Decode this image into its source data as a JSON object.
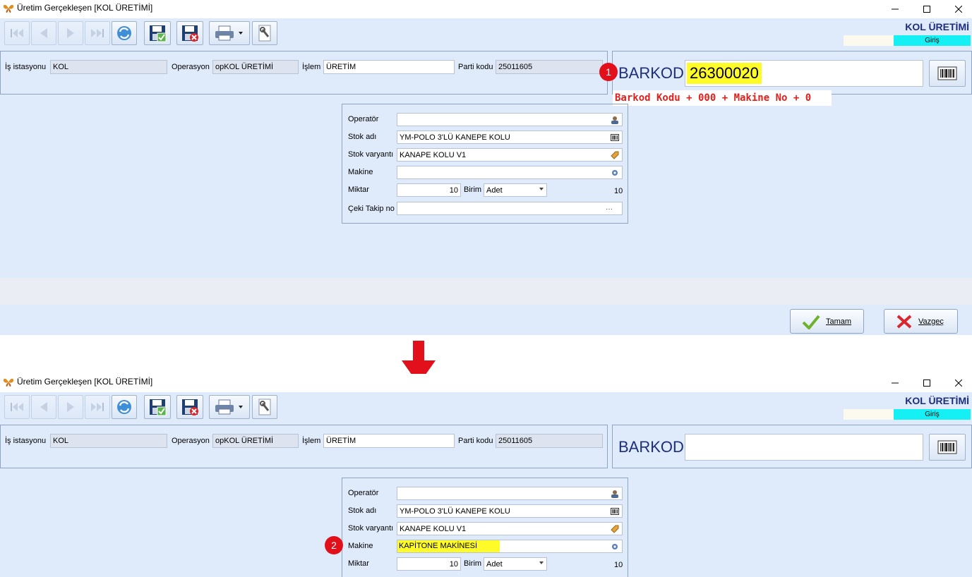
{
  "window": {
    "title": "Üretim Gerçekleşen [KOL ÜRETİMİ]",
    "header_title": "KOL ÜRETİMİ",
    "status": "Giriş"
  },
  "info": {
    "is_istasyonu_label": "İş istasyonu",
    "is_istasyonu_value": "KOL",
    "operasyon_label": "Operasyon",
    "operasyon_value": "opKOL ÜRETİMİ",
    "islem_label": "İşlem",
    "islem_value": "ÜRETİM",
    "parti_kodu_label": "Parti kodu",
    "parti_kodu_value": "25011605"
  },
  "barcode": {
    "label": "BARKOD",
    "value_before": "26300020",
    "value_after": "",
    "hint": "Barkod Kodu + 000 + Makine No + 0"
  },
  "form": {
    "operator_label": "Operatör",
    "operator_value": "",
    "stok_adi_label": "Stok adı",
    "stok_adi_value": "YM-POLO 3'LÜ KANEPE KOLU",
    "stok_varyanti_label": "Stok varyantı",
    "stok_varyanti_value": "KANAPE KOLU V1",
    "makine_label": "Makine",
    "makine_value_before": "",
    "makine_value_after": "KAPİTONE MAKİNESİ",
    "miktar_label": "Miktar",
    "miktar_value": "10",
    "birim_label": "Birim",
    "birim_value": "Adet",
    "miktar_total": "10",
    "ceki_label": "Çeki Takip no",
    "ceki_value": "",
    "ellipsis": "···"
  },
  "buttons": {
    "ok": "Tamam",
    "cancel": "Vazgeç"
  },
  "annotations": {
    "step1": "1",
    "step2": "2"
  },
  "colors": {
    "window_bg": "#dfeafb",
    "highlight": "#fffb28",
    "status_cyan": "#14f0f4",
    "badge_red": "#e2101a",
    "title_blue": "#1d2f7a",
    "hint_red": "#e0211e"
  },
  "icons": [
    "butterfly-app-icon",
    "first-record-icon",
    "prev-record-icon",
    "next-record-icon",
    "last-record-icon",
    "refresh-icon",
    "save-icon",
    "delete-icon",
    "print-icon",
    "tools-icon",
    "barcode-icon",
    "person-icon",
    "tag-icon",
    "gear-icon",
    "check-icon",
    "x-icon",
    "down-arrow-icon"
  ]
}
